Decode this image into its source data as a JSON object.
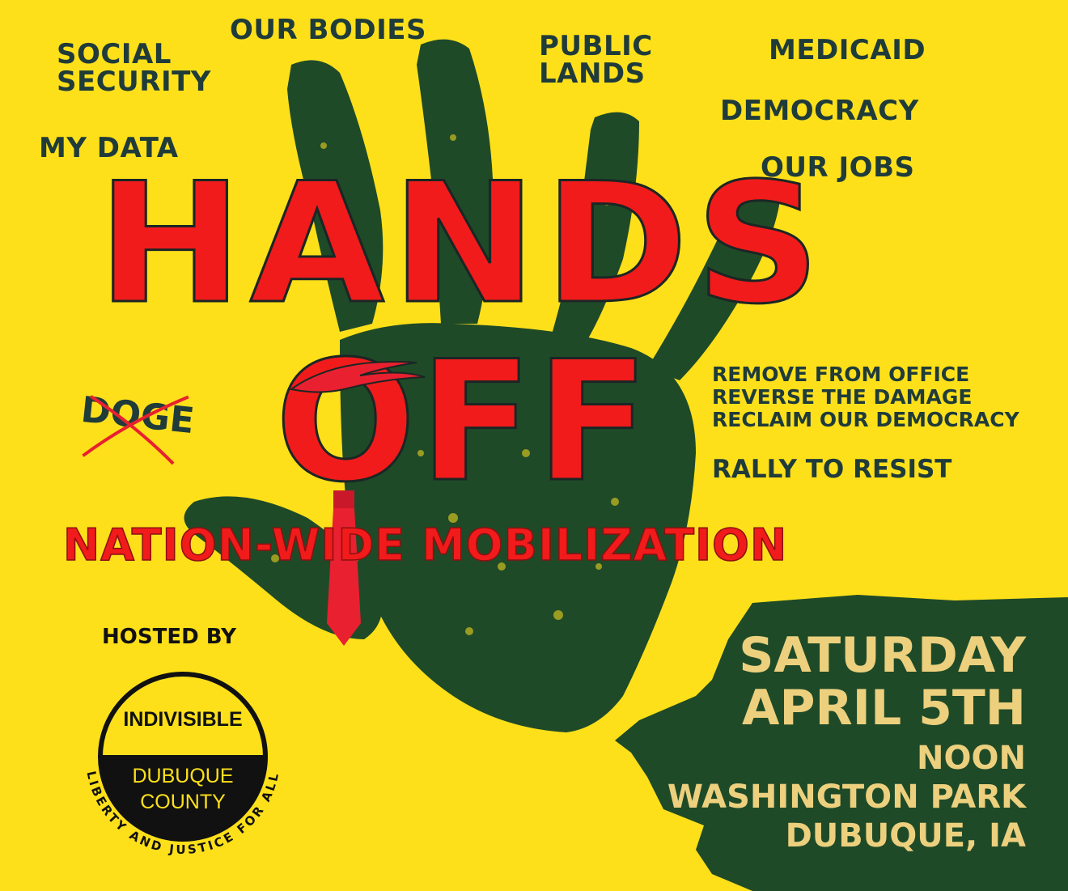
{
  "topics": {
    "social_security_1": "SOCIAL",
    "social_security_2": "SECURITY",
    "our_bodies": "OUR BODIES",
    "public_lands_1": "PUBLIC",
    "public_lands_2": "LANDS",
    "medicaid": "MEDICAID",
    "democracy": "DEMOCRACY",
    "my_data": "MY DATA",
    "our_jobs": "OUR JOBS"
  },
  "title": {
    "line1": "HANDS",
    "line2": "OFF"
  },
  "subtitle": "NATION-WIDE  MOBILIZATION",
  "doge": "DOGE",
  "goals": {
    "line1": "REMOVE FROM OFFICE",
    "line2": "REVERSE THE DAMAGE",
    "line3": "RECLAIM OUR DEMOCRACY",
    "rally": "RALLY TO RESIST"
  },
  "host": {
    "label": "HOSTED BY",
    "logo_top": "INDIVISIBLE",
    "logo_bottom_1": "DUBUQUE",
    "logo_bottom_2": "COUNTY",
    "logo_ring": "LIBERTY AND JUSTICE FOR ALL"
  },
  "event": {
    "day": "SATURDAY",
    "date": "APRIL 5TH",
    "time": "NOON",
    "place": "WASHINGTON PARK",
    "city": "DUBUQUE, IA"
  },
  "colors": {
    "background": "#fde01a",
    "hand": "#1f4a28",
    "title_red": "#f11b1b",
    "text_dark": "#1f3b3a",
    "event_text": "#ecd07e",
    "event_band": "#1d4226"
  },
  "icons": [
    "handprint-icon",
    "necktie-icon",
    "cross-out-icon",
    "indivisible-logo"
  ]
}
